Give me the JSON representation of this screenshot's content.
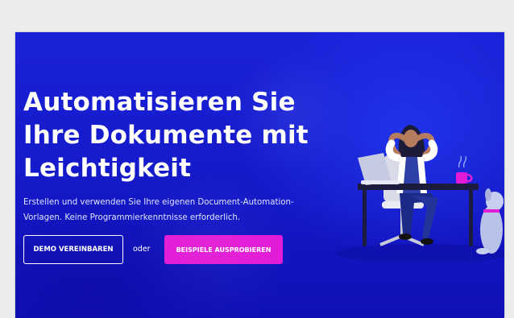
{
  "hero": {
    "headline_lines": [
      "Automatisieren Sie",
      "Ihre Dokumente mit",
      "Leichtigkeit"
    ],
    "subtext_lines": [
      "Erstellen und verwenden Sie Ihre eigenen Document-Automation-",
      "Vorlagen. Keine Programmierkenntnisse erforderlich."
    ],
    "demo_button_label": "DEMO VEREINBAREN",
    "or_label": "oder",
    "try_button_label": "BEISPIELE AUSPROBIEREN"
  },
  "illustration": {
    "name": "woman-relaxing-at-desk-illustration",
    "elements": [
      "laptop-icon",
      "coffee-mug-icon",
      "dog-icon",
      "office-chair-icon",
      "desk-icon"
    ]
  },
  "colors": {
    "hero_background": "#1418c6",
    "primary_cta": "#e21bd6",
    "text": "#ffffff",
    "page_background": "#ececec"
  }
}
